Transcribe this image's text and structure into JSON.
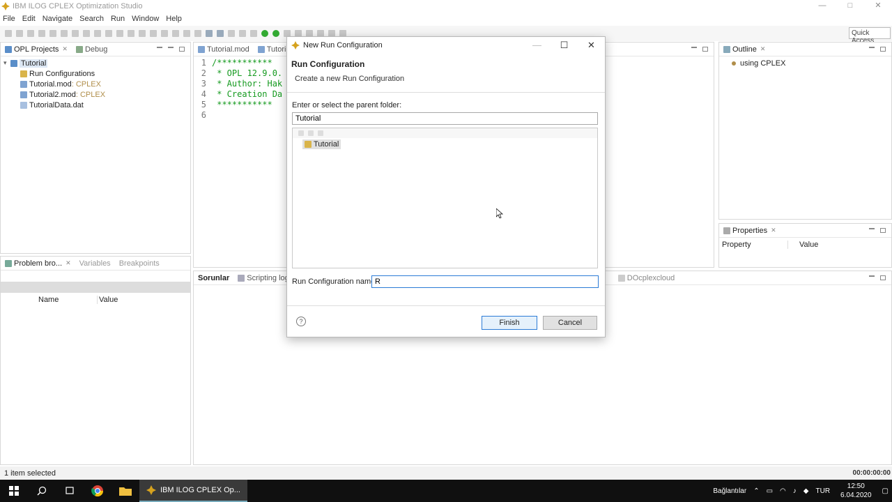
{
  "window": {
    "title": "IBM ILOG CPLEX Optimization Studio",
    "controls": [
      "—",
      "□",
      "✕"
    ]
  },
  "menu": [
    "File",
    "Edit",
    "Navigate",
    "Search",
    "Run",
    "Window",
    "Help"
  ],
  "toolbar": {
    "quick_access": "Quick Access"
  },
  "projects_panel": {
    "tabs": [
      "OPL Projects",
      "Debug"
    ],
    "tree": {
      "root": "Tutorial",
      "items": [
        {
          "label": "Run Configurations",
          "suffix": ""
        },
        {
          "label": "Tutorial.mod",
          "suffix": " : CPLEX"
        },
        {
          "label": "Tutorial2.mod",
          "suffix": " : CPLEX"
        },
        {
          "label": "TutorialData.dat",
          "suffix": ""
        }
      ]
    }
  },
  "editor": {
    "tabs": [
      "Tutorial.mod",
      "Tutori"
    ],
    "lines": [
      {
        "n": "1",
        "text": "/***********"
      },
      {
        "n": "2",
        "text": " * OPL 12.9.0."
      },
      {
        "n": "3",
        "text": " * Author: Hak"
      },
      {
        "n": "4",
        "text": " * Creation Da"
      },
      {
        "n": "5",
        "text": " ***********"
      },
      {
        "n": "6",
        "text": ""
      }
    ]
  },
  "outline_panel": {
    "tab": "Outline",
    "item": "using CPLEX"
  },
  "properties_panel": {
    "tab": "Properties",
    "columns": [
      "Property",
      "Value"
    ]
  },
  "problem_panel": {
    "tabs": [
      "Problem bro...",
      "Variables",
      "Breakpoints"
    ],
    "columns": [
      "Name",
      "Value"
    ]
  },
  "bottom_panel": {
    "tabs": [
      "Sorunlar",
      "Scripting log"
    ],
    "right_tab": "DOcplexcloud"
  },
  "dialog": {
    "title": "New Run Configuration",
    "heading": "Run Configuration",
    "subheading": "Create a new Run Configuration",
    "folder_label": "Enter or select the parent folder:",
    "folder_value": "Tutorial",
    "tree_item": "Tutorial",
    "name_label": "Run Configuration name:",
    "name_value": "R",
    "help": "?",
    "finish": "Finish",
    "cancel": "Cancel"
  },
  "status": {
    "left": "1 item selected",
    "timer": "00:00:00:00"
  },
  "taskbar": {
    "app": "IBM ILOG CPLEX Op...",
    "tray_label": "Bağlantılar",
    "lang": "TUR",
    "time": "12:50",
    "date": "6.04.2020"
  }
}
